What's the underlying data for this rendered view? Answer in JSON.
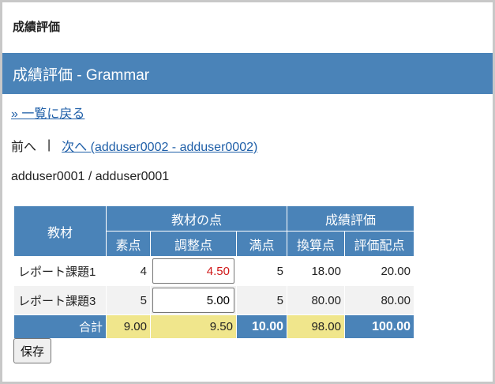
{
  "header": {
    "title": "成績評価"
  },
  "title_bar": {
    "title": "成績評価 - Grammar"
  },
  "nav": {
    "back_link": "» 一覧に戻る",
    "prev_label": "前へ",
    "separator": "|",
    "next_link": "次へ (adduser0002 - adduser0002)"
  },
  "user": {
    "label": "adduser0001 / adduser0001"
  },
  "table": {
    "headers": {
      "material": "教材",
      "material_points": "教材の点",
      "grade_eval": "成績評価",
      "raw": "素点",
      "adjusted": "調整点",
      "full": "満点",
      "converted": "換算点",
      "allocated": "評価配点"
    },
    "rows": [
      {
        "name": "レポート課題1",
        "raw": "4",
        "adjusted": "4.50",
        "full": "5",
        "converted": "18.00",
        "allocated": "20.00"
      },
      {
        "name": "レポート課題3",
        "raw": "5",
        "adjusted": "5.00",
        "full": "5",
        "converted": "80.00",
        "allocated": "80.00"
      }
    ],
    "total": {
      "label": "合計",
      "raw": "9.00",
      "adjusted": "9.50",
      "full": "10.00",
      "converted": "98.00",
      "allocated": "100.00"
    }
  },
  "actions": {
    "save_label": "保存"
  },
  "colors": {
    "primary": "#4a83b8",
    "highlight": "#f0e68c",
    "changed_value": "#d01818",
    "link": "#1f5fa8"
  }
}
